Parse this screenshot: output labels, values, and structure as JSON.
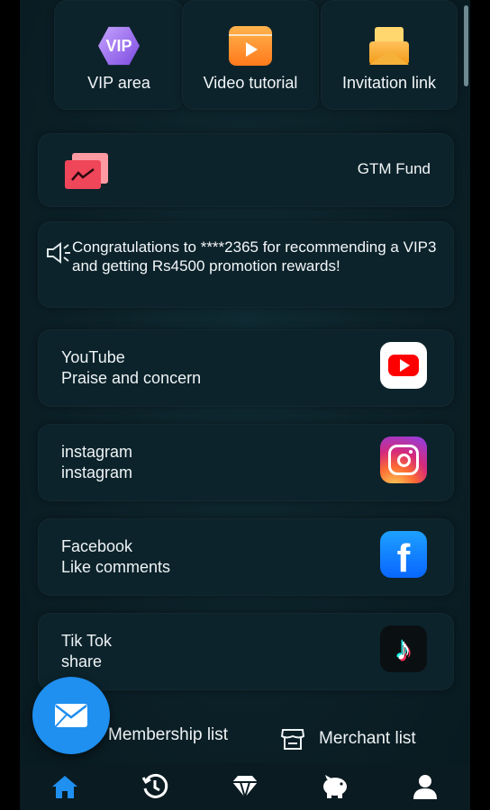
{
  "quick_links": [
    {
      "label": "VIP area",
      "icon": "vip-icon",
      "icon_text": "VIP"
    },
    {
      "label": "Video tutorial",
      "icon": "video-icon"
    },
    {
      "label": "Invitation link",
      "icon": "envelope-icon"
    }
  ],
  "fund": {
    "label": "GTM Fund",
    "icon": "chart-icon"
  },
  "notice": {
    "icon": "speaker-icon",
    "message": "Congratulations to ****2365 for recommending a VIP3 and getting Rs4500 promotion rewards!"
  },
  "socials": [
    {
      "title": "YouTube",
      "subtitle": "Praise and concern",
      "icon": "youtube-icon"
    },
    {
      "title": "instagram",
      "subtitle": "instagram",
      "icon": "instagram-icon"
    },
    {
      "title": "Facebook",
      "subtitle": "Like comments",
      "icon": "facebook-icon"
    },
    {
      "title": "Tik Tok",
      "subtitle": "share",
      "icon": "tiktok-icon"
    }
  ],
  "lists": {
    "membership_label": "Membership list",
    "merchant_label": "Merchant list"
  },
  "fab": {
    "icon": "mail-icon"
  },
  "tabs": [
    "home-icon",
    "history-icon",
    "vip-diamond-icon",
    "piggy-bank-icon",
    "profile-icon"
  ],
  "colors": {
    "accent": "#1f8ff0",
    "background": "#0b1f26",
    "active_tab": "#1f8ff0"
  }
}
